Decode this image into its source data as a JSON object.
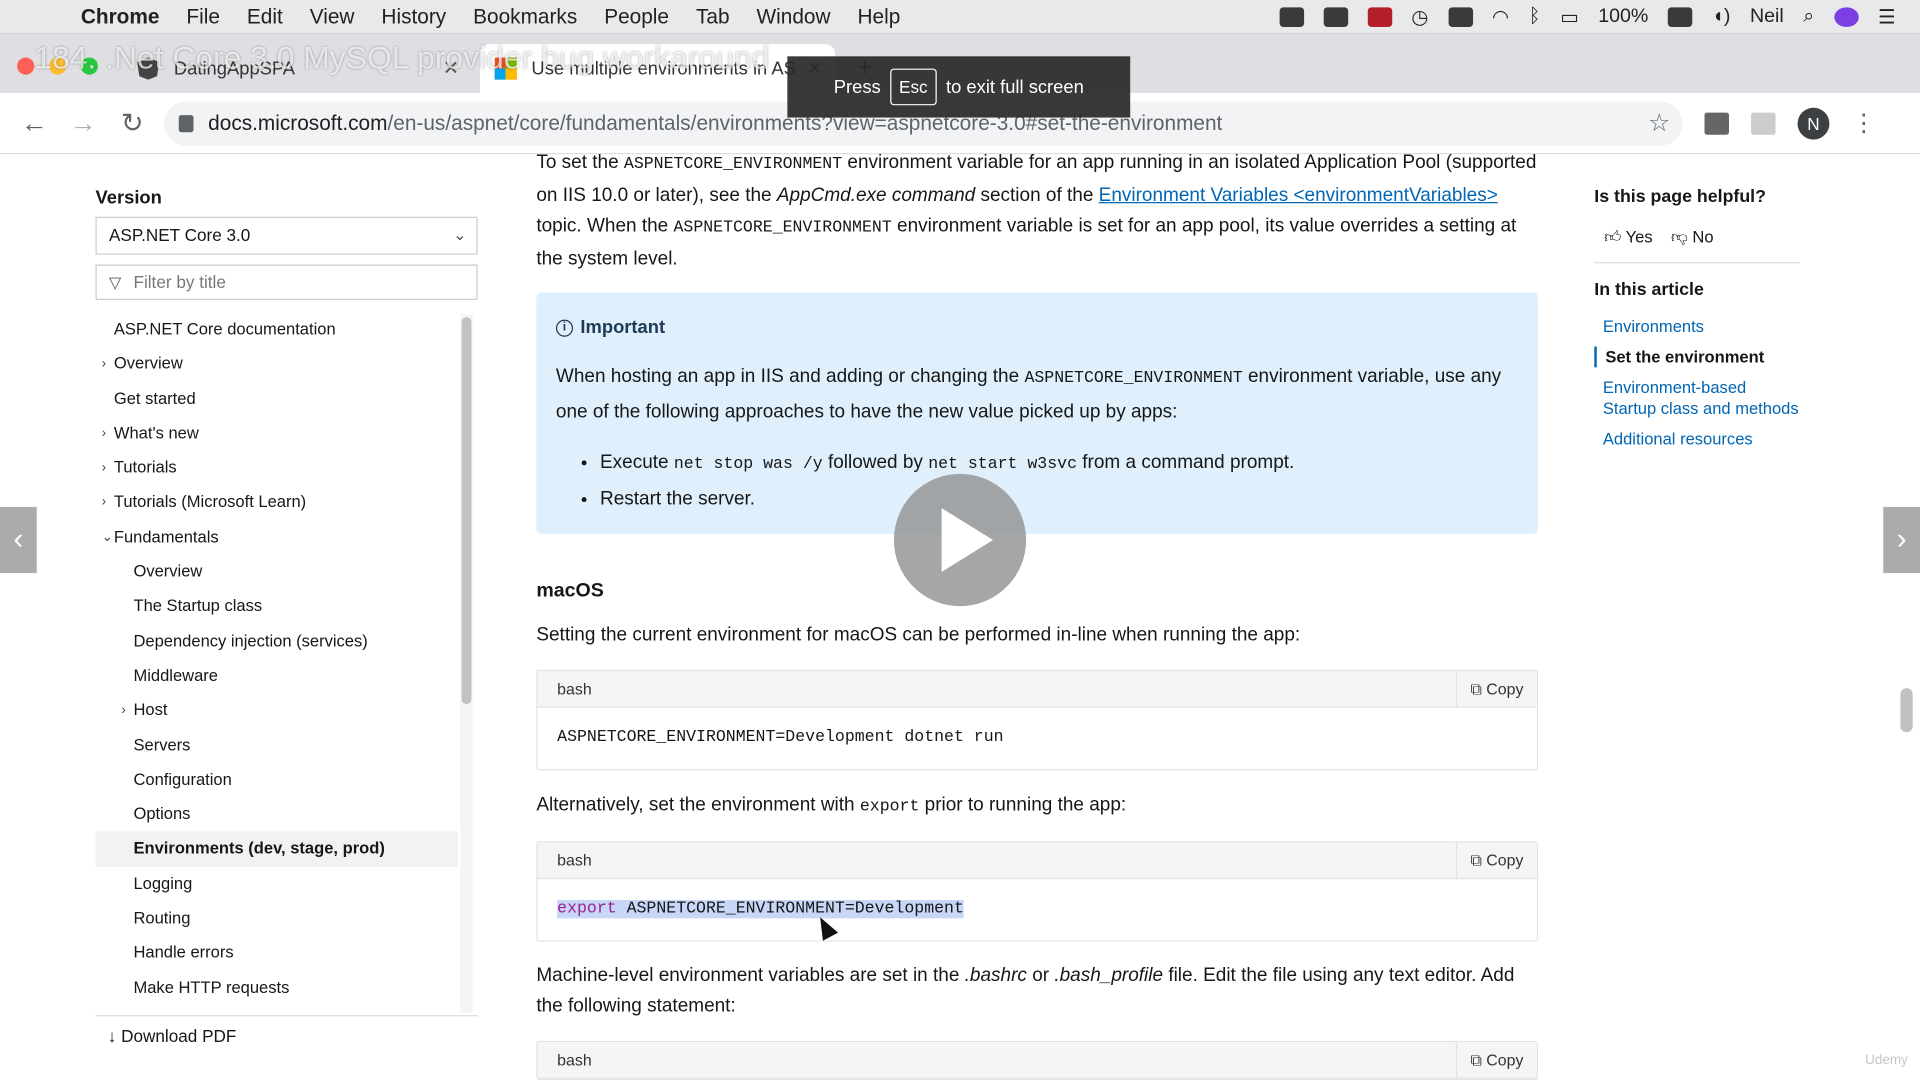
{
  "menubar": {
    "app": "Chrome",
    "items": [
      "File",
      "Edit",
      "View",
      "History",
      "Bookmarks",
      "People",
      "Tab",
      "Window",
      "Help"
    ],
    "battery": "100%",
    "user": "Neil"
  },
  "video_title": "184. .Net Core 3.0 MySQL provider bug workaround",
  "tabs": [
    {
      "title": "DatingAppSPA",
      "icon": "angular-icon"
    },
    {
      "title": "Use multiple environments in AS",
      "icon": "microsoft-icon"
    }
  ],
  "toast": {
    "pre": "Press",
    "key": "Esc",
    "post": "to exit full screen"
  },
  "address": {
    "host": "docs.microsoft.com",
    "path": "/en-us/aspnet/core/fundamentals/environments?view=aspnetcore-3.0#set-the-environment"
  },
  "profile_initial": "N",
  "leftnav": {
    "version_label": "Version",
    "version_value": "ASP.NET Core 3.0",
    "filter_placeholder": "Filter by title",
    "items": [
      {
        "label": "ASP.NET Core documentation",
        "depth": 0,
        "arrow": ""
      },
      {
        "label": "Overview",
        "depth": 0,
        "arrow": "›"
      },
      {
        "label": "Get started",
        "depth": 0,
        "arrow": ""
      },
      {
        "label": "What's new",
        "depth": 0,
        "arrow": "›"
      },
      {
        "label": "Tutorials",
        "depth": 0,
        "arrow": "›"
      },
      {
        "label": "Tutorials (Microsoft Learn)",
        "depth": 0,
        "arrow": "›"
      },
      {
        "label": "Fundamentals",
        "depth": 0,
        "arrow": "⌄"
      },
      {
        "label": "Overview",
        "depth": 1,
        "arrow": ""
      },
      {
        "label": "The Startup class",
        "depth": 1,
        "arrow": ""
      },
      {
        "label": "Dependency injection (services)",
        "depth": 1,
        "arrow": ""
      },
      {
        "label": "Middleware",
        "depth": 1,
        "arrow": ""
      },
      {
        "label": "Host",
        "depth": 1,
        "arrow": "›"
      },
      {
        "label": "Servers",
        "depth": 1,
        "arrow": ""
      },
      {
        "label": "Configuration",
        "depth": 1,
        "arrow": ""
      },
      {
        "label": "Options",
        "depth": 1,
        "arrow": ""
      },
      {
        "label": "Environments (dev, stage, prod)",
        "depth": 1,
        "arrow": "",
        "active": true
      },
      {
        "label": "Logging",
        "depth": 1,
        "arrow": ""
      },
      {
        "label": "Routing",
        "depth": 1,
        "arrow": ""
      },
      {
        "label": "Handle errors",
        "depth": 1,
        "arrow": ""
      },
      {
        "label": "Make HTTP requests",
        "depth": 1,
        "arrow": ""
      }
    ],
    "download_pdf": "Download PDF"
  },
  "article": {
    "intro_1": "To set the ",
    "intro_code": "ASPNETCORE_ENVIRONMENT",
    "intro_2": " environment variable for an app running in an isolated Application Pool (supported on IIS 10.0 or later), see the ",
    "intro_em": "AppCmd.exe command",
    "intro_3": " section of the ",
    "intro_link": "Environment Variables <environmentVariables>",
    "intro_4": " topic. When the ",
    "intro_code2": "ASPNETCORE_ENVIRONMENT",
    "intro_5": " environment variable is set for an app pool, its value overrides a setting at the system level.",
    "alert_title": "Important",
    "alert_1": "When hosting an app in IIS and adding or changing the ",
    "alert_code": "ASPNETCORE_ENVIRONMENT",
    "alert_2": " environment variable, use any one of the following approaches to have the new value picked up by apps:",
    "bullet1_a": "Execute ",
    "bullet1_code1": "net stop was /y",
    "bullet1_b": " followed by ",
    "bullet1_code2": "net start w3svc",
    "bullet1_c": " from a command prompt.",
    "bullet2": "Restart the server.",
    "macos_heading": "macOS",
    "macos_p": "Setting the current environment for macOS can be performed in-line when running the app:",
    "code1_lang": "bash",
    "code1": "ASPNETCORE_ENVIRONMENT=Development dotnet run",
    "alt_1": "Alternatively, set the environment with ",
    "alt_code": "export",
    "alt_2": " prior to running the app:",
    "code2_lang": "bash",
    "code2_kw": "export",
    "code2_rest": " ASPNETCORE_ENVIRONMENT=Development",
    "machine_1": "Machine-level environment variables are set in the ",
    "machine_em1": ".bashrc",
    "machine_2": " or ",
    "machine_em2": ".bash_profile",
    "machine_3": " file. Edit the file using any text editor. Add the following statement:",
    "code3_lang": "bash",
    "copy_label": "Copy"
  },
  "rail": {
    "helpful": "Is this page helpful?",
    "yes": "Yes",
    "no": "No",
    "in_article": "In this article",
    "links": [
      "Environments",
      "Set the environment",
      "Environment-based Startup class and methods",
      "Additional resources"
    ],
    "current_index": 1
  },
  "watermark": "Udemy"
}
